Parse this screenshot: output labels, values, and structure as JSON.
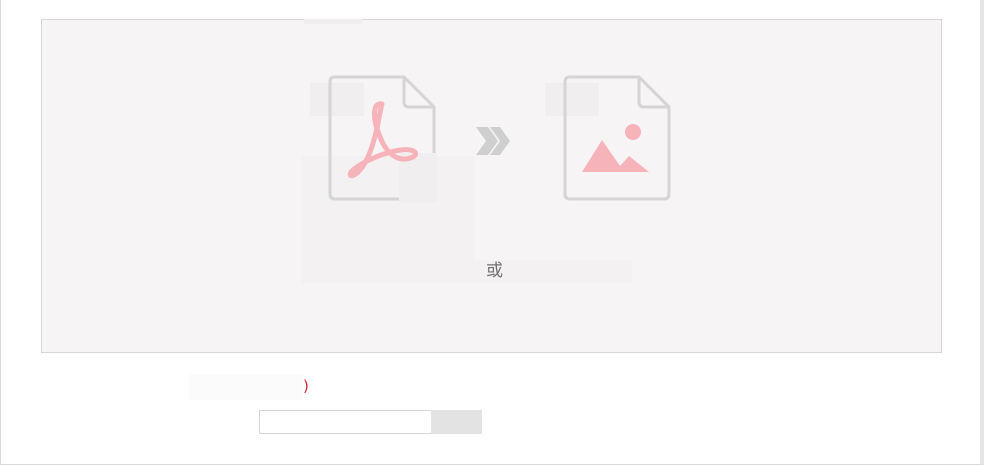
{
  "upload_area": {
    "or_label": "或",
    "pdf_icon": "pdf-file-icon",
    "arrow_icon": "double-chevron-right-icon",
    "image_icon": "image-file-icon",
    "colors": {
      "background": "#f6f4f5",
      "icon_outline": "#d5d5d5",
      "icon_accent": "#f6b3b9",
      "arrow": "#cfcfcf"
    }
  },
  "url_form": {
    "required_mark": ")",
    "input_value": "",
    "input_placeholder": "",
    "submit_label": ""
  }
}
